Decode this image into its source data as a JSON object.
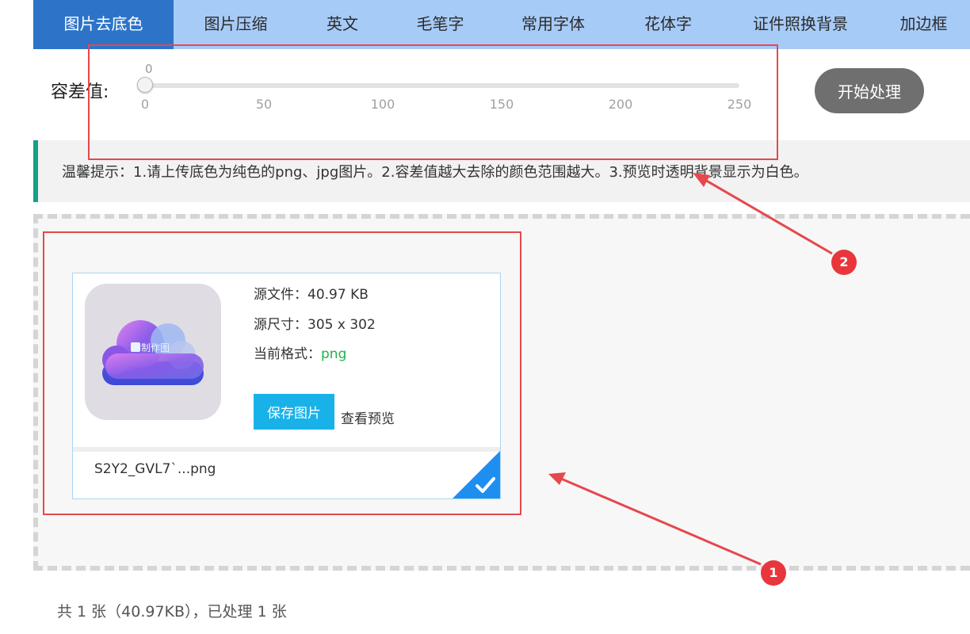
{
  "tabs": [
    {
      "label": "图片去底色",
      "active": true
    },
    {
      "label": "图片压缩",
      "active": false
    },
    {
      "label": "英文",
      "active": false
    },
    {
      "label": "毛笔字",
      "active": false
    },
    {
      "label": "常用字体",
      "active": false
    },
    {
      "label": "花体字",
      "active": false
    },
    {
      "label": "证件照换背景",
      "active": false
    },
    {
      "label": "加边框",
      "active": false
    }
  ],
  "tolerance": {
    "label": "容差值:",
    "current": "0",
    "ticks": [
      "0",
      "50",
      "100",
      "150",
      "200",
      "250"
    ],
    "value": 0,
    "min": 0,
    "max": 250
  },
  "start_button": "开始处理",
  "tip": "温馨提示：1.请上传底色为纯色的png、jpg图片。2.容差值越大去除的颜色范围越大。3.预览时透明背景显示为白色。",
  "file": {
    "size_line": "源文件：40.97 KB",
    "dims_line": "源尺寸：305 x 302",
    "format_label": "当前格式：",
    "format_value": "png",
    "save_button": "保存图片",
    "preview_link": "查看预览",
    "filename": "S2Y2_GVL7`...png",
    "logo_text": "制作图"
  },
  "summary": "共 1 张（40.97KB），已处理 1 张",
  "annotations": {
    "badge1": "1",
    "badge2": "2"
  },
  "colors": {
    "tab_active": "#2d74c9",
    "tab_bar": "#a7cbf7",
    "save_button": "#18b2e9",
    "format_green": "#22b14c",
    "annotation_red": "#e5484d",
    "tip_accent": "#16a087"
  }
}
